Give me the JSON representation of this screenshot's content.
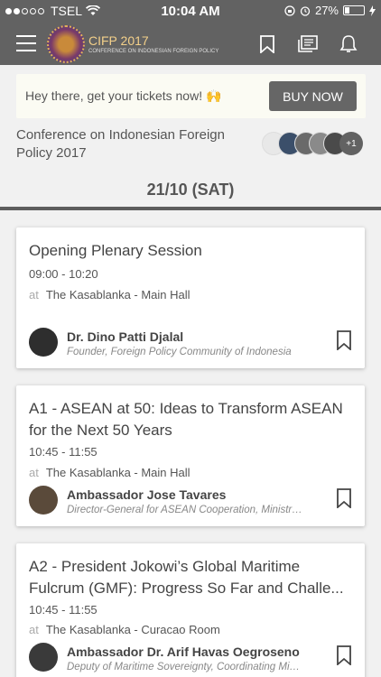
{
  "status_bar": {
    "carrier": "TSEL",
    "time": "10:04 AM",
    "battery": "27%",
    "battery_level": 0.27,
    "signal_bars": 2
  },
  "app_bar": {
    "logo_title": "CIFP 2017",
    "logo_subtitle": "CONFERENCE ON INDONESIAN FOREIGN POLICY",
    "icons": [
      "menu-icon",
      "bookmark-icon",
      "feedback-icon",
      "bell-icon"
    ]
  },
  "ticket_banner": {
    "text": "Hey there, get your tickets now! 🙌",
    "button_label": "BUY NOW"
  },
  "conference": {
    "title": "Conference on Indonesian Foreign Policy 2017",
    "attendee_extra": "+1"
  },
  "day": {
    "date_label": "21/10 (SAT)"
  },
  "sessions": [
    {
      "title": "Opening Plenary Session",
      "time": "09:00 - 10:20",
      "at": "at",
      "venue": "The Kasablanka - Main Hall",
      "speaker_name": "Dr. Dino Patti Djalal",
      "speaker_role": "Founder, Foreign Policy Community of Indonesia"
    },
    {
      "title": "A1 - ASEAN at 50: Ideas to Transform ASEAN for the Next 50 Years",
      "time": "10:45 - 11:55",
      "at": "at",
      "venue": "The Kasablanka - Main Hall",
      "speaker_name": "Ambassador Jose Tavares",
      "speaker_role": "Director-General for ASEAN Cooperation, Ministry o..."
    },
    {
      "title": "A2 - President Jokowi’s Global Maritime Fulcrum (GMF): Progress So Far and Challe...",
      "time": "10:45 - 11:55",
      "at": "at",
      "venue": "The Kasablanka - Curacao Room",
      "speaker_name": "Ambassador Dr. Arif Havas Oegroseno",
      "speaker_role": "Deputy of Maritime Sovereignty, Coordinating Mini..."
    }
  ]
}
